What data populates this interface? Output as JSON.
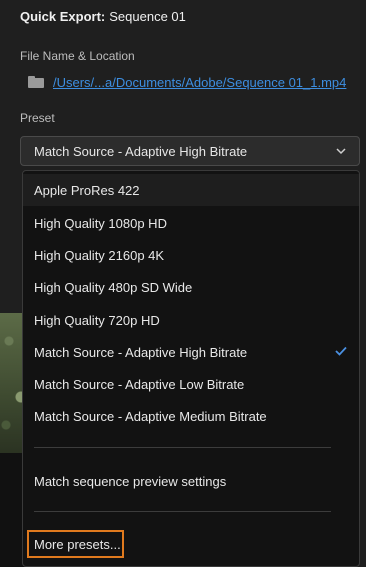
{
  "header": {
    "title_prefix": "Quick Export:",
    "title_value": "Sequence 01"
  },
  "file": {
    "label": "File Name & Location",
    "path": "/Users/...a/Documents/Adobe/Sequence 01_1.mp4",
    "icon": "folder-icon"
  },
  "preset": {
    "label": "Preset",
    "selected": "Match Source - Adaptive High Bitrate",
    "icon": "chevron-down-icon",
    "options": [
      "Apple ProRes 422",
      "High Quality 1080p HD",
      "High Quality 2160p 4K",
      "High Quality 480p SD Wide",
      "High Quality 720p HD",
      "Match Source - Adaptive High Bitrate",
      "Match Source - Adaptive Low Bitrate",
      "Match Source - Adaptive Medium Bitrate"
    ],
    "match_sequence": "Match sequence preview settings",
    "more": "More presets..."
  },
  "colors": {
    "link": "#3d8ee0",
    "check": "#4a90e2",
    "highlight_border": "#e07a1e"
  }
}
